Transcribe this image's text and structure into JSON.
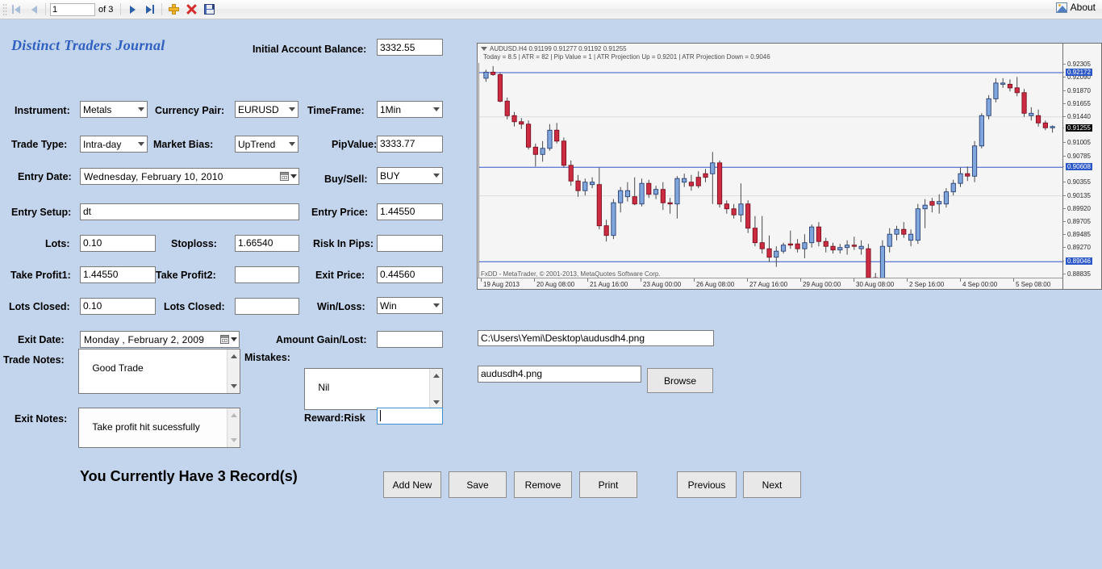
{
  "toolbar": {
    "first_icon": "first-record-icon",
    "prev_icon": "previous-record-icon",
    "page_value": "1",
    "of_label": "of 3",
    "next_icon": "next-record-icon",
    "last_icon": "last-record-icon",
    "add_icon": "add-record-icon",
    "delete_icon": "delete-record-icon",
    "save_icon": "save-record-icon",
    "about_label": "About",
    "about_icon": "about-image-icon"
  },
  "app": {
    "title": "Distinct Traders Journal"
  },
  "form": {
    "initial_balance_label": "Initial Account Balance:",
    "initial_balance_value": "3332.55",
    "instrument_label": "Instrument:",
    "instrument_value": "Metals",
    "currency_pair_label": "Currency Pair:",
    "currency_pair_value": "EURUSD",
    "timeframe_label": "TimeFrame:",
    "timeframe_value": "1Min",
    "trade_type_label": "Trade Type:",
    "trade_type_value": "Intra-day",
    "market_bias_label": "Market Bias:",
    "market_bias_value": "UpTrend",
    "pip_value_label": "PipValue:",
    "pip_value_value": "3333.77",
    "entry_date_label": "Entry Date:",
    "entry_date_value": "Wednesday,   February  10, 2010",
    "buy_sell_label": "Buy/Sell:",
    "buy_sell_value": "BUY",
    "entry_setup_label": "Entry Setup:",
    "entry_setup_value": "dt",
    "entry_price_label": "Entry Price:",
    "entry_price_value": "1.44550",
    "lots_label": "Lots:",
    "lots_value": "0.10",
    "stoploss_label": "Stoploss:",
    "stoploss_value": "1.66540",
    "risk_in_pips_label": "Risk In Pips:",
    "risk_in_pips_value": "",
    "take_profit1_label": "Take Profit1:",
    "take_profit1_value": "1.44550",
    "take_profit2_label": "Take Profit2:",
    "take_profit2_value": "",
    "exit_price_label": "Exit Price:",
    "exit_price_value": "0.44560",
    "lots_closed1_label": "Lots Closed:",
    "lots_closed1_value": "0.10",
    "lots_closed2_label": "Lots Closed:",
    "lots_closed2_value": "",
    "win_loss_label": "Win/Loss:",
    "win_loss_value": "Win",
    "exit_date_label": "Exit Date:",
    "exit_date_value": "Monday    ,   February    2, 2009",
    "amount_gain_lost_label": "Amount Gain/Lost:",
    "amount_gain_lost_value": "",
    "trade_notes_label": "Trade Notes:",
    "trade_notes_value": "Good Trade",
    "mistakes_label": "Mistakes:",
    "mistakes_value": "Nil",
    "exit_notes_label": "Exit Notes:",
    "exit_notes_value": "Take profit hit sucessfully",
    "reward_risk_label": "Reward:Risk",
    "reward_risk_value": "",
    "records_text": "You Currently Have 3 Record(s)",
    "image_path_value": "C:\\Users\\Yemi\\Desktop\\audusdh4.png",
    "image_name_value": "audusdh4.png",
    "browse_label": "Browse"
  },
  "buttons": {
    "add_new": "Add New",
    "save": "Save",
    "remove": "Remove",
    "print": "Print",
    "previous": "Previous",
    "next": "Next"
  },
  "chart_data": {
    "type": "candlestick",
    "title": "AUDUSD.H4  0.91199 0.91277 0.91192 0.91255",
    "subtitle": "Today = 8.5   |    ATR = 82   |   Pip Value = 1   |   ATR Projection Up = 0.9201   |   ATR Projection Down = 0.9046",
    "symbol": "AUDUSD.H4",
    "ohlc": {
      "open": "0.91199",
      "high": "0.91277",
      "low": "0.91192",
      "close": "0.91255"
    },
    "indicators": {
      "today": "8.5",
      "atr": "82",
      "pip_value": "1",
      "atr_projection_up": "0.9201",
      "atr_projection_down": "0.9046"
    },
    "footer": "FxDD - MetaTrader, © 2001-2013, MetaQuotes Software Corp.",
    "ylabel": "",
    "xlabel": "",
    "ylim": [
      0.88835,
      0.92305
    ],
    "grid": true,
    "legend": "none",
    "y_ticks": [
      "0.92305",
      "0.92090",
      "0.91870",
      "0.91655",
      "0.91440",
      "0.91005",
      "0.90785",
      "0.90355",
      "0.90135",
      "0.89920",
      "0.89705",
      "0.89485",
      "0.89270",
      "0.88835"
    ],
    "y_highlights": [
      {
        "label": "0.92172",
        "kind": "blue"
      },
      {
        "label": "0.91255",
        "kind": "black"
      },
      {
        "label": "0.90608",
        "kind": "blue"
      },
      {
        "label": "0.89046",
        "kind": "blue"
      }
    ],
    "x_ticks": [
      "19 Aug 2013",
      "20 Aug 08:00",
      "21 Aug 16:00",
      "23 Aug 00:00",
      "26 Aug 08:00",
      "27 Aug 16:00",
      "29 Aug 00:00",
      "30 Aug 08:00",
      "2 Sep 16:00",
      "4 Sep 00:00",
      "5 Sep 08:00"
    ],
    "hlines": [
      {
        "value": 0.92172,
        "color": "#3355cc"
      },
      {
        "value": 0.90608,
        "color": "#3355cc"
      },
      {
        "value": 0.89046,
        "color": "#3355cc"
      }
    ],
    "candles": [
      [
        0.9208,
        0.9222,
        0.9202,
        0.9218,
        "up"
      ],
      [
        0.9218,
        0.9228,
        0.9212,
        0.9214,
        "down"
      ],
      [
        0.9214,
        0.9218,
        0.9168,
        0.917,
        "down"
      ],
      [
        0.917,
        0.9176,
        0.914,
        0.9146,
        "down"
      ],
      [
        0.9146,
        0.9152,
        0.9128,
        0.9136,
        "down"
      ],
      [
        0.9136,
        0.9142,
        0.9124,
        0.9132,
        "down"
      ],
      [
        0.9132,
        0.9138,
        0.909,
        0.9094,
        "down"
      ],
      [
        0.9094,
        0.91,
        0.9062,
        0.9082,
        "down"
      ],
      [
        0.9082,
        0.9104,
        0.907,
        0.9092,
        "up"
      ],
      [
        0.9092,
        0.9132,
        0.9088,
        0.9122,
        "up"
      ],
      [
        0.9122,
        0.9134,
        0.91,
        0.9104,
        "down"
      ],
      [
        0.9104,
        0.911,
        0.906,
        0.9064,
        "down"
      ],
      [
        0.9064,
        0.9072,
        0.903,
        0.9038,
        "down"
      ],
      [
        0.9038,
        0.9048,
        0.9012,
        0.9022,
        "down"
      ],
      [
        0.9022,
        0.9042,
        0.9014,
        0.9036,
        "up"
      ],
      [
        0.9036,
        0.9044,
        0.9026,
        0.9032,
        "up"
      ],
      [
        0.9032,
        0.906,
        0.8958,
        0.8964,
        "down"
      ],
      [
        0.8964,
        0.8974,
        0.8938,
        0.8948,
        "down"
      ],
      [
        0.8948,
        0.9008,
        0.8942,
        0.9002,
        "up"
      ],
      [
        0.9002,
        0.9028,
        0.8986,
        0.9022,
        "up"
      ],
      [
        0.9022,
        0.9036,
        0.9004,
        0.9012,
        "up"
      ],
      [
        0.9012,
        0.9044,
        0.8998,
        0.9,
        "down"
      ],
      [
        0.9,
        0.9042,
        0.8996,
        0.9034,
        "up"
      ],
      [
        0.9034,
        0.904,
        0.901,
        0.9016,
        "down"
      ],
      [
        0.9016,
        0.903,
        0.9008,
        0.9024,
        "up"
      ],
      [
        0.9024,
        0.9036,
        0.899,
        0.9002,
        "down"
      ],
      [
        0.9002,
        0.901,
        0.8984,
        0.9,
        "down"
      ],
      [
        0.9,
        0.9046,
        0.8976,
        0.9042,
        "up"
      ],
      [
        0.9042,
        0.905,
        0.9028,
        0.9036,
        "up"
      ],
      [
        0.9036,
        0.9048,
        0.9022,
        0.903,
        "down"
      ],
      [
        0.903,
        0.9054,
        0.9026,
        0.9044,
        "down"
      ],
      [
        0.9044,
        0.9058,
        0.9036,
        0.905,
        "down"
      ],
      [
        0.905,
        0.9086,
        0.9,
        0.9068,
        "up"
      ],
      [
        0.9068,
        0.9072,
        0.8994,
        0.9,
        "down"
      ],
      [
        0.9,
        0.9006,
        0.8984,
        0.8992,
        "down"
      ],
      [
        0.8992,
        0.9,
        0.8976,
        0.8982,
        "down"
      ],
      [
        0.8982,
        0.9034,
        0.897,
        0.9,
        "up"
      ],
      [
        0.9,
        0.9006,
        0.8952,
        0.896,
        "down"
      ],
      [
        0.896,
        0.898,
        0.893,
        0.8936,
        "down"
      ],
      [
        0.8936,
        0.898,
        0.8918,
        0.8926,
        "down"
      ],
      [
        0.8926,
        0.8948,
        0.8904,
        0.8912,
        "down"
      ],
      [
        0.8912,
        0.893,
        0.8896,
        0.8922,
        "up"
      ],
      [
        0.8922,
        0.8936,
        0.8918,
        0.8932,
        "up"
      ],
      [
        0.8932,
        0.8956,
        0.8926,
        0.8934,
        "down"
      ],
      [
        0.8934,
        0.8942,
        0.892,
        0.8926,
        "down"
      ],
      [
        0.8926,
        0.895,
        0.891,
        0.8936,
        "up"
      ],
      [
        0.8936,
        0.8966,
        0.8928,
        0.8962,
        "up"
      ],
      [
        0.8962,
        0.897,
        0.893,
        0.8938,
        "down"
      ],
      [
        0.8938,
        0.8944,
        0.892,
        0.893,
        "down"
      ],
      [
        0.893,
        0.8936,
        0.8918,
        0.8924,
        "down"
      ],
      [
        0.8924,
        0.8934,
        0.8918,
        0.8928,
        "up"
      ],
      [
        0.8928,
        0.894,
        0.8916,
        0.8932,
        "up"
      ],
      [
        0.8932,
        0.8946,
        0.8924,
        0.893,
        "down"
      ],
      [
        0.893,
        0.894,
        0.8916,
        0.8926,
        "up"
      ],
      [
        0.8926,
        0.8934,
        0.8872,
        0.8878,
        "down"
      ],
      [
        0.8878,
        0.8886,
        0.887,
        0.8874,
        "down"
      ],
      [
        0.8874,
        0.894,
        0.8872,
        0.893,
        "up"
      ],
      [
        0.893,
        0.896,
        0.892,
        0.895,
        "up"
      ],
      [
        0.895,
        0.8964,
        0.894,
        0.8958,
        "up"
      ],
      [
        0.8958,
        0.897,
        0.8944,
        0.895,
        "down"
      ],
      [
        0.895,
        0.8958,
        0.893,
        0.894,
        "up"
      ],
      [
        0.894,
        0.9,
        0.8934,
        0.8992,
        "up"
      ],
      [
        0.8992,
        0.9008,
        0.896,
        0.8998,
        "up"
      ],
      [
        0.8998,
        0.901,
        0.8986,
        0.9004,
        "down"
      ],
      [
        0.9004,
        0.9016,
        0.8984,
        0.9,
        "up"
      ],
      [
        0.9,
        0.9026,
        0.8994,
        0.902,
        "up"
      ],
      [
        0.902,
        0.904,
        0.9014,
        0.9034,
        "up"
      ],
      [
        0.9034,
        0.906,
        0.9028,
        0.905,
        "up"
      ],
      [
        0.905,
        0.9062,
        0.9038,
        0.9046,
        "down"
      ],
      [
        0.9046,
        0.9104,
        0.9036,
        0.9096,
        "up"
      ],
      [
        0.9096,
        0.915,
        0.9092,
        0.9146,
        "up"
      ],
      [
        0.9146,
        0.918,
        0.914,
        0.9174,
        "up"
      ],
      [
        0.9174,
        0.9208,
        0.9168,
        0.92,
        "up"
      ],
      [
        0.92,
        0.9208,
        0.9192,
        0.9198,
        "up"
      ],
      [
        0.9198,
        0.9206,
        0.9186,
        0.9192,
        "down"
      ],
      [
        0.9192,
        0.921,
        0.9178,
        0.9184,
        "down"
      ],
      [
        0.9184,
        0.919,
        0.9144,
        0.915,
        "down"
      ],
      [
        0.915,
        0.916,
        0.9138,
        0.9146,
        "up"
      ],
      [
        0.9146,
        0.9156,
        0.9128,
        0.9134,
        "down"
      ],
      [
        0.9134,
        0.9138,
        0.9122,
        0.9126,
        "down"
      ],
      [
        0.9126,
        0.913,
        0.9118,
        0.9128,
        "up"
      ]
    ]
  }
}
